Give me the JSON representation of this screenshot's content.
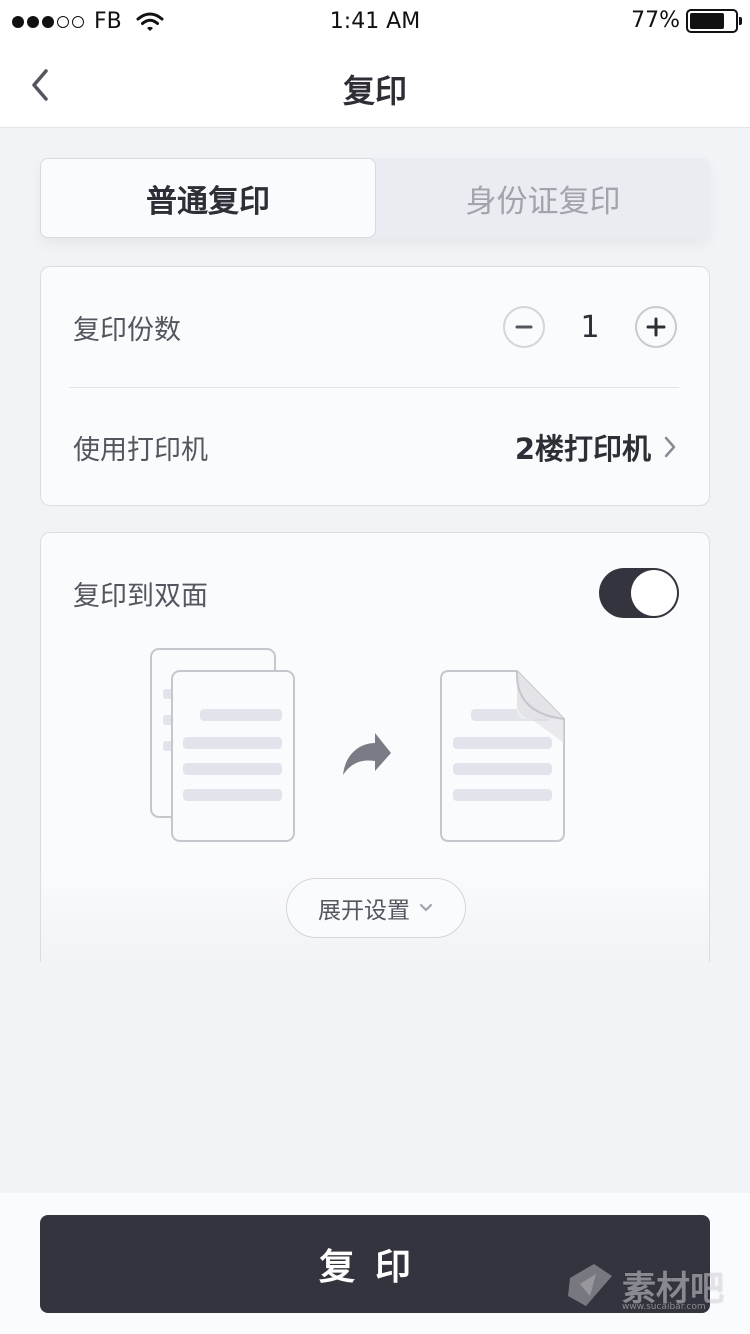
{
  "status_bar": {
    "carrier": "FB",
    "time": "1:41 AM",
    "battery_text": "77%",
    "battery_level": 0.77,
    "signal_filled": 3,
    "signal_total": 5
  },
  "nav": {
    "title": "复印",
    "back_icon": "chevron-left-icon"
  },
  "tabs": [
    {
      "label": "普通复印",
      "active": true
    },
    {
      "label": "身份证复印",
      "active": false
    }
  ],
  "copies": {
    "label": "复印份数",
    "value": "1"
  },
  "printer": {
    "label": "使用打印机",
    "value": "2楼打印机"
  },
  "duplex": {
    "label": "复印到双面",
    "enabled": true
  },
  "expand_settings": {
    "label": "展开设置"
  },
  "primary_action": {
    "label": "复印"
  },
  "watermark": {
    "text": "素材吧",
    "sub": "www.sucaibar.com"
  },
  "colors": {
    "background": "#f2f3f6",
    "card": "#fafbfd",
    "primary": "#34343e",
    "text_dark": "#2e2e36",
    "text_muted": "#55555f"
  }
}
